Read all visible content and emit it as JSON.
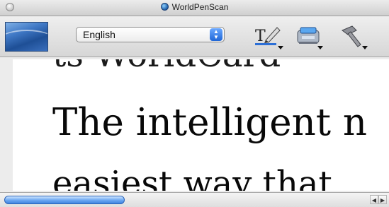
{
  "window": {
    "title": "WorldPenScan"
  },
  "toolbar": {
    "language_select": {
      "value": "English"
    },
    "tools": [
      {
        "name": "text-style-icon"
      },
      {
        "name": "scanner-icon"
      },
      {
        "name": "hammer-icon"
      }
    ]
  },
  "document": {
    "lines": [
      "ts WorldCard",
      "The intelligent n",
      "easiest way that"
    ]
  },
  "colors": {
    "scroll_thumb": "#69a6f1",
    "toolbar_bg": "#e0e0e0",
    "logo_blue": "#3f78c5"
  },
  "scroll": {
    "horizontal_position": 0.0
  }
}
